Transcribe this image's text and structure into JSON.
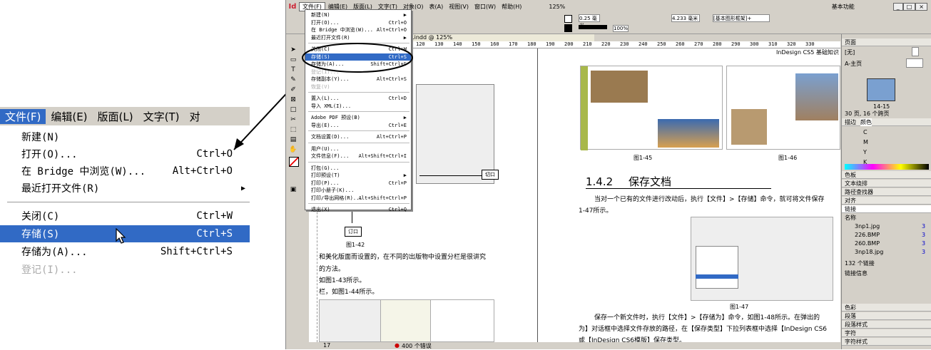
{
  "zoom": {
    "menubar": [
      "文件(F)",
      "编辑(E)",
      "版面(L)",
      "文字(T)",
      "对"
    ],
    "items": [
      {
        "label": "新建(N)",
        "shortcut": ""
      },
      {
        "label": "打开(O)...",
        "shortcut": "Ctrl+O"
      },
      {
        "label": "在 Bridge 中浏览(W)...",
        "shortcut": "Alt+Ctrl+O"
      },
      {
        "label": "最近打开文件(R)",
        "shortcut": "▶"
      },
      {
        "label": "关闭(C)",
        "shortcut": "Ctrl+W"
      },
      {
        "label": "存储(S)",
        "shortcut": "Ctrl+S"
      },
      {
        "label": "存储为(A)...",
        "shortcut": "Shift+Ctrl+S"
      },
      {
        "label": "登记(I)...",
        "shortcut": ""
      }
    ]
  },
  "app": {
    "logo": "Id",
    "menubar": [
      "文件(F)",
      "编辑(E)",
      "版面(L)",
      "文字(T)",
      "对象(O)",
      "表(A)",
      "视图(V)",
      "窗口(W)",
      "帮助(H)"
    ],
    "zoom_level": "125%",
    "workspace": "基本功能",
    "doc_tab": "1.indd @ 125%",
    "stroke_weight": "0.25 毫米",
    "width_value": "4.233 毫米",
    "frame_style": "[基本图形框架]+",
    "scale": "100%",
    "ruler_marks": [
      "120",
      "130",
      "140",
      "150",
      "160",
      "170",
      "180",
      "190",
      "200",
      "210",
      "220",
      "230",
      "240",
      "250",
      "260",
      "270",
      "280",
      "290",
      "300",
      "310",
      "320",
      "330"
    ],
    "status_page": "17",
    "status_errors": "400 个错误"
  },
  "dropdown": [
    {
      "label": "新建(N)",
      "shortcut": "▶"
    },
    {
      "label": "打开(O)...",
      "shortcut": "Ctrl+O"
    },
    {
      "label": "在 Bridge 中浏览(W)...",
      "shortcut": "Alt+Ctrl+O"
    },
    {
      "label": "最近打开文件(R)",
      "shortcut": "▶"
    },
    {
      "label": "关闭(C)",
      "shortcut": "Ctrl+W"
    },
    {
      "label": "存储(S)",
      "shortcut": "Ctrl+S"
    },
    {
      "label": "存储为(A)...",
      "shortcut": "Shift+Ctrl+S"
    },
    {
      "label": "登记(I)...",
      "shortcut": ""
    },
    {
      "label": "存储副本(Y)...",
      "shortcut": "Alt+Ctrl+S"
    },
    {
      "label": "恢复(V)",
      "shortcut": ""
    },
    {
      "label": "置入(L)...",
      "shortcut": "Ctrl+D"
    },
    {
      "label": "导入 XML(I)...",
      "shortcut": ""
    },
    {
      "label": "Adobe PDF 预设(B)",
      "shortcut": "▶"
    },
    {
      "label": "导出(E)...",
      "shortcut": "Ctrl+E"
    },
    {
      "label": "文档设置(D)...",
      "shortcut": "Alt+Ctrl+P"
    },
    {
      "label": "用户(U)...",
      "shortcut": ""
    },
    {
      "label": "文件信息(F)...",
      "shortcut": "Alt+Shift+Ctrl+I"
    },
    {
      "label": "打包(G)...",
      "shortcut": ""
    },
    {
      "label": "打印预设(T)",
      "shortcut": "▶"
    },
    {
      "label": "打印(P)...",
      "shortcut": "Ctrl+P"
    },
    {
      "label": "打印小册子(K)...",
      "shortcut": ""
    },
    {
      "label": "打印/导出网格(R)...",
      "shortcut": "Alt+Shift+Ctrl+P"
    },
    {
      "label": "退出(X)",
      "shortcut": "Ctrl+Q"
    }
  ],
  "page": {
    "header": "InDesign CS5 基础知识",
    "fig45": "图1-45",
    "fig46": "图1-46",
    "section": "1.4.2",
    "section_title": "保存文档",
    "para1a": "当对一个已有的文件进行改动后，执行【文件】>【存储】命令，就可将文件保存",
    "para1b": "1-47所示。",
    "fig47": "图1-47",
    "para2a": "保存一个新文件时，执行【文件】>【存储为】命令，如图1-48所示。在弹出的",
    "para2b": "为】对话框中选择文件存放的路径，在【保存类型】下拉列表框中选择【InDesign CS6",
    "para2c": "或【InDesign CS6模版】保存类型。",
    "callout1": "切口",
    "callout2": "订口",
    "fig42": "图1-42",
    "left1": "和美化版面而设置的，在不同的出版物中设置分栏是很讲究",
    "left2": "的方法。",
    "left3": "如图1-43所示。",
    "left4": "栏，如图1-44所示。"
  },
  "panels": {
    "pages_tab": "页面",
    "none": "[无]",
    "master": "A-主页",
    "spread": "14-15",
    "pages_count": "30 页, 16 个跨页",
    "stroke_tab": "描边",
    "color_tab": "颜色",
    "c": "C",
    "m": "M",
    "y": "Y",
    "k": "K",
    "swatches": "色板",
    "text_wrap": "文本绕排",
    "path_finder": "路径查找器",
    "align": "对齐",
    "links": "链接",
    "links_name": "名称",
    "link_items": [
      "3np1.jpg",
      "226.BMP",
      "260.BMP",
      "3np18.jpg"
    ],
    "link_pages": [
      "3",
      "3",
      "3",
      "3"
    ],
    "link_count": "132 个链接",
    "link_info": "链接信息",
    "effects": "色彩",
    "para": "段落",
    "para_style": "段落样式",
    "char": "字符",
    "char_style": "字符样式"
  },
  "colors": {
    "highlight": "#316ac5",
    "chrome": "#d4d0c8"
  }
}
